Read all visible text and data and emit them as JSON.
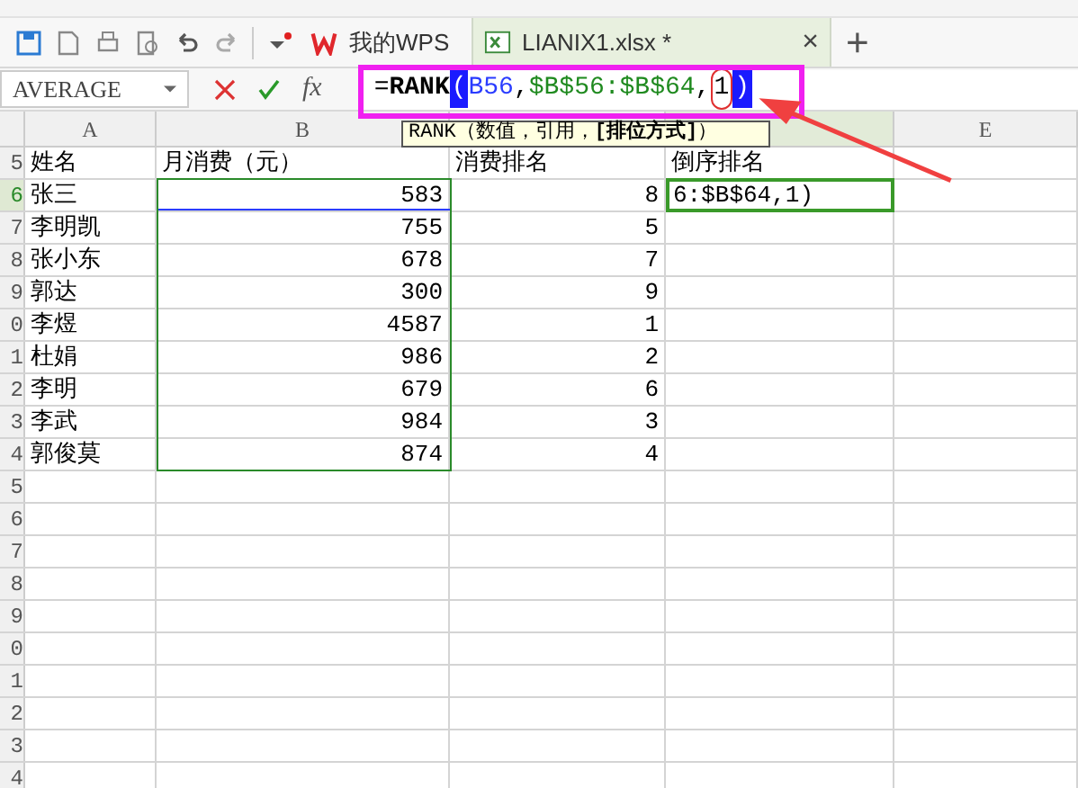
{
  "tabs": [
    {
      "label": "我的WPS",
      "selected": false,
      "kind": "home"
    },
    {
      "label": "LIANIX1.xlsx *",
      "selected": true,
      "kind": "file"
    }
  ],
  "tab_close": "×",
  "new_tab": "+",
  "name_box": "AVERAGE",
  "fx": "fx",
  "formula": [
    {
      "text": "=",
      "kind": "plain"
    },
    {
      "text": "RANK",
      "kind": "bold"
    },
    {
      "text": "(",
      "kind": "highlight"
    },
    {
      "text": "B56",
      "kind": "ref_blue"
    },
    {
      "text": ",",
      "kind": "plain"
    },
    {
      "text": "$B$56:$B$64",
      "kind": "ref_green"
    },
    {
      "text": ",",
      "kind": "plain"
    },
    {
      "text": "1",
      "kind": "circled"
    },
    {
      "text": ")",
      "kind": "highlight"
    }
  ],
  "tooltip": "RANK（数值，引用，**[排位方式]**）",
  "columns": [
    {
      "label": "A"
    },
    {
      "label": "B"
    },
    {},
    {},
    {
      "label": "E"
    }
  ],
  "rows": [
    {
      "num": "5",
      "active": false,
      "cells": [
        "姓名",
        "月消费（元）",
        "消费排名",
        "倒序排名"
      ]
    },
    {
      "num": "6",
      "active": true,
      "cells": [
        "张三",
        "583",
        "8",
        "6:$B$64,1)"
      ]
    },
    {
      "num": "7",
      "active": false,
      "cells": [
        "李明凯",
        "755",
        "5"
      ]
    },
    {
      "num": "8",
      "active": false,
      "cells": [
        "张小东",
        "678",
        "7"
      ]
    },
    {
      "num": "9",
      "active": false,
      "cells": [
        "郭达",
        "300",
        "9"
      ]
    },
    {
      "num": "0",
      "active": false,
      "cells": [
        "李煜",
        "4587",
        "1"
      ]
    },
    {
      "num": "1",
      "active": false,
      "cells": [
        "杜娟",
        "986",
        "2"
      ]
    },
    {
      "num": "2",
      "active": false,
      "cells": [
        "李明",
        "679",
        "6"
      ]
    },
    {
      "num": "3",
      "active": false,
      "cells": [
        "李武",
        "984",
        "3"
      ]
    },
    {
      "num": "4",
      "active": false,
      "cells": [
        "郭俊莫",
        "874",
        "4"
      ]
    },
    {
      "num": "5",
      "active": false,
      "cells": []
    },
    {
      "num": "6",
      "active": false,
      "cells": []
    },
    {
      "num": "7",
      "active": false,
      "cells": []
    },
    {
      "num": "8",
      "active": false,
      "cells": []
    },
    {
      "num": "9",
      "active": false,
      "cells": []
    },
    {
      "num": "0",
      "active": false,
      "cells": []
    },
    {
      "num": "1",
      "active": false,
      "cells": []
    },
    {
      "num": "2",
      "active": false,
      "cells": []
    },
    {
      "num": "3",
      "active": false,
      "cells": []
    },
    {
      "num": "4",
      "active": false,
      "cells": []
    }
  ]
}
